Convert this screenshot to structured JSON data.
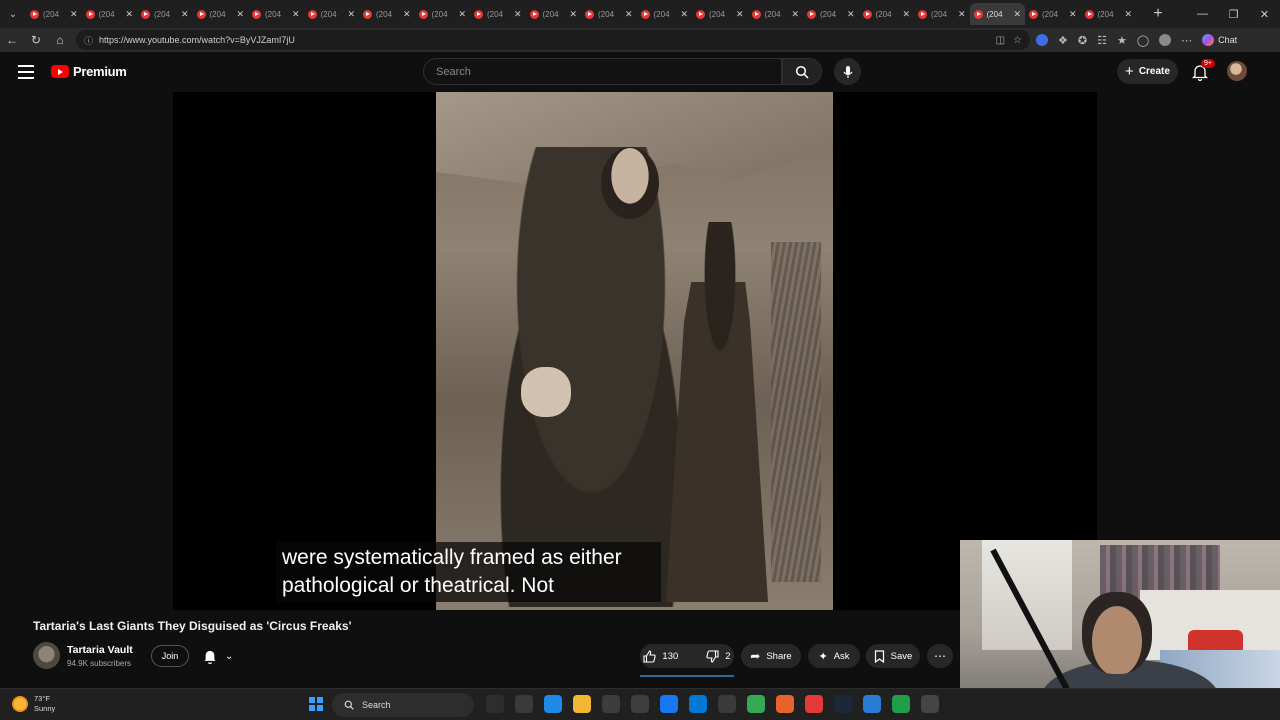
{
  "browser": {
    "tab_title": "(204",
    "tab_count": 20,
    "active_tab_index": 17,
    "url": "https://www.youtube.com/watch?v=ByVJZamI7jU",
    "chat_label": "Chat"
  },
  "youtube": {
    "logo_text": "Premium",
    "search_placeholder": "Search",
    "create_label": "Create",
    "notification_badge": "9+"
  },
  "video": {
    "caption_line1": "were systematically framed as either",
    "caption_line2": "pathological or theatrical. Not",
    "title": "Tartaria's Last Giants They Disguised as 'Circus Freaks'",
    "channel_name": "Tartaria Vault",
    "subscribers": "94.9K subscribers",
    "join_label": "Join",
    "likes": "130",
    "dislikes": "2",
    "share_label": "Share",
    "ask_label": "Ask",
    "save_label": "Save"
  },
  "taskbar": {
    "temperature": "73°F",
    "condition": "Sunny",
    "search_label": "Search",
    "app_colors": [
      "#2d2d2d",
      "#3a3a3a",
      "#1e88e5",
      "#f2b632",
      "#3c3c3c",
      "#3d3d3d",
      "#1877f2",
      "#0078d4",
      "#3a3a3a",
      "#34a853",
      "#e8622c",
      "#e53935",
      "#1b2838",
      "#2a7bd4",
      "#1e9e4a",
      "#444444"
    ]
  },
  "colors": {
    "accent_red": "#ff0000",
    "background": "#0f0f0f",
    "like_highlight": "#3ea6ff"
  }
}
